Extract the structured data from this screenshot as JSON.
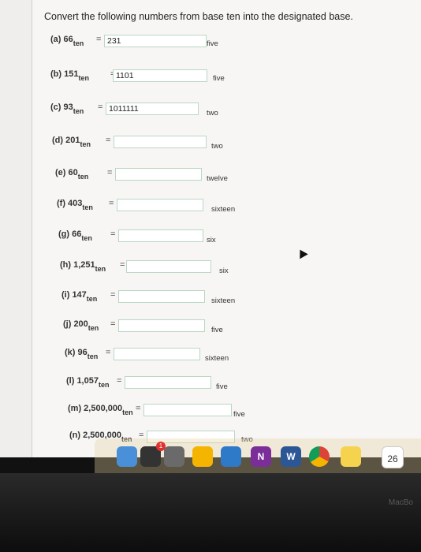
{
  "instruction": "Convert the following numbers from base ten into the designated base.",
  "sub_label": "ten",
  "equals": "=",
  "rows": [
    {
      "label": "(a)",
      "number": "66",
      "value": "231",
      "base": "five"
    },
    {
      "label": "(b)",
      "number": "151",
      "value": "1101",
      "base": "five"
    },
    {
      "label": "(c)",
      "number": "93",
      "value": "1011111",
      "base": "two"
    },
    {
      "label": "(d)",
      "number": "201",
      "value": "",
      "base": "two"
    },
    {
      "label": "(e)",
      "number": "60",
      "value": "",
      "base": "twelve"
    },
    {
      "label": "(f)",
      "number": "403",
      "value": "",
      "base": "sixteen"
    },
    {
      "label": "(g)",
      "number": "66",
      "value": "",
      "base": "six"
    },
    {
      "label": "(h)",
      "number": "1,251",
      "value": "",
      "base": "six"
    },
    {
      "label": "(i)",
      "number": "147",
      "value": "",
      "base": "sixteen"
    },
    {
      "label": "(j)",
      "number": "200",
      "value": "",
      "base": "five"
    },
    {
      "label": "(k)",
      "number": "96",
      "value": "",
      "base": "sixteen"
    },
    {
      "label": "(l)",
      "number": "1,057",
      "value": "",
      "base": "five"
    },
    {
      "label": "(m)",
      "number": "2,500,000",
      "value": "",
      "base": "five"
    },
    {
      "label": "(n)",
      "number": "2,500,000",
      "value": "",
      "base": "two"
    }
  ],
  "dock": {
    "calendar_day": "26",
    "badge": "1",
    "icons": [
      "finder-icon",
      "photo-booth-icon",
      "launchpad-icon",
      "slides-icon",
      "presentation-icon",
      "onenote-icon",
      "word-icon",
      "chrome-icon",
      "stickies-icon",
      "calendar-icon"
    ]
  },
  "bezel_text": "MacBo"
}
